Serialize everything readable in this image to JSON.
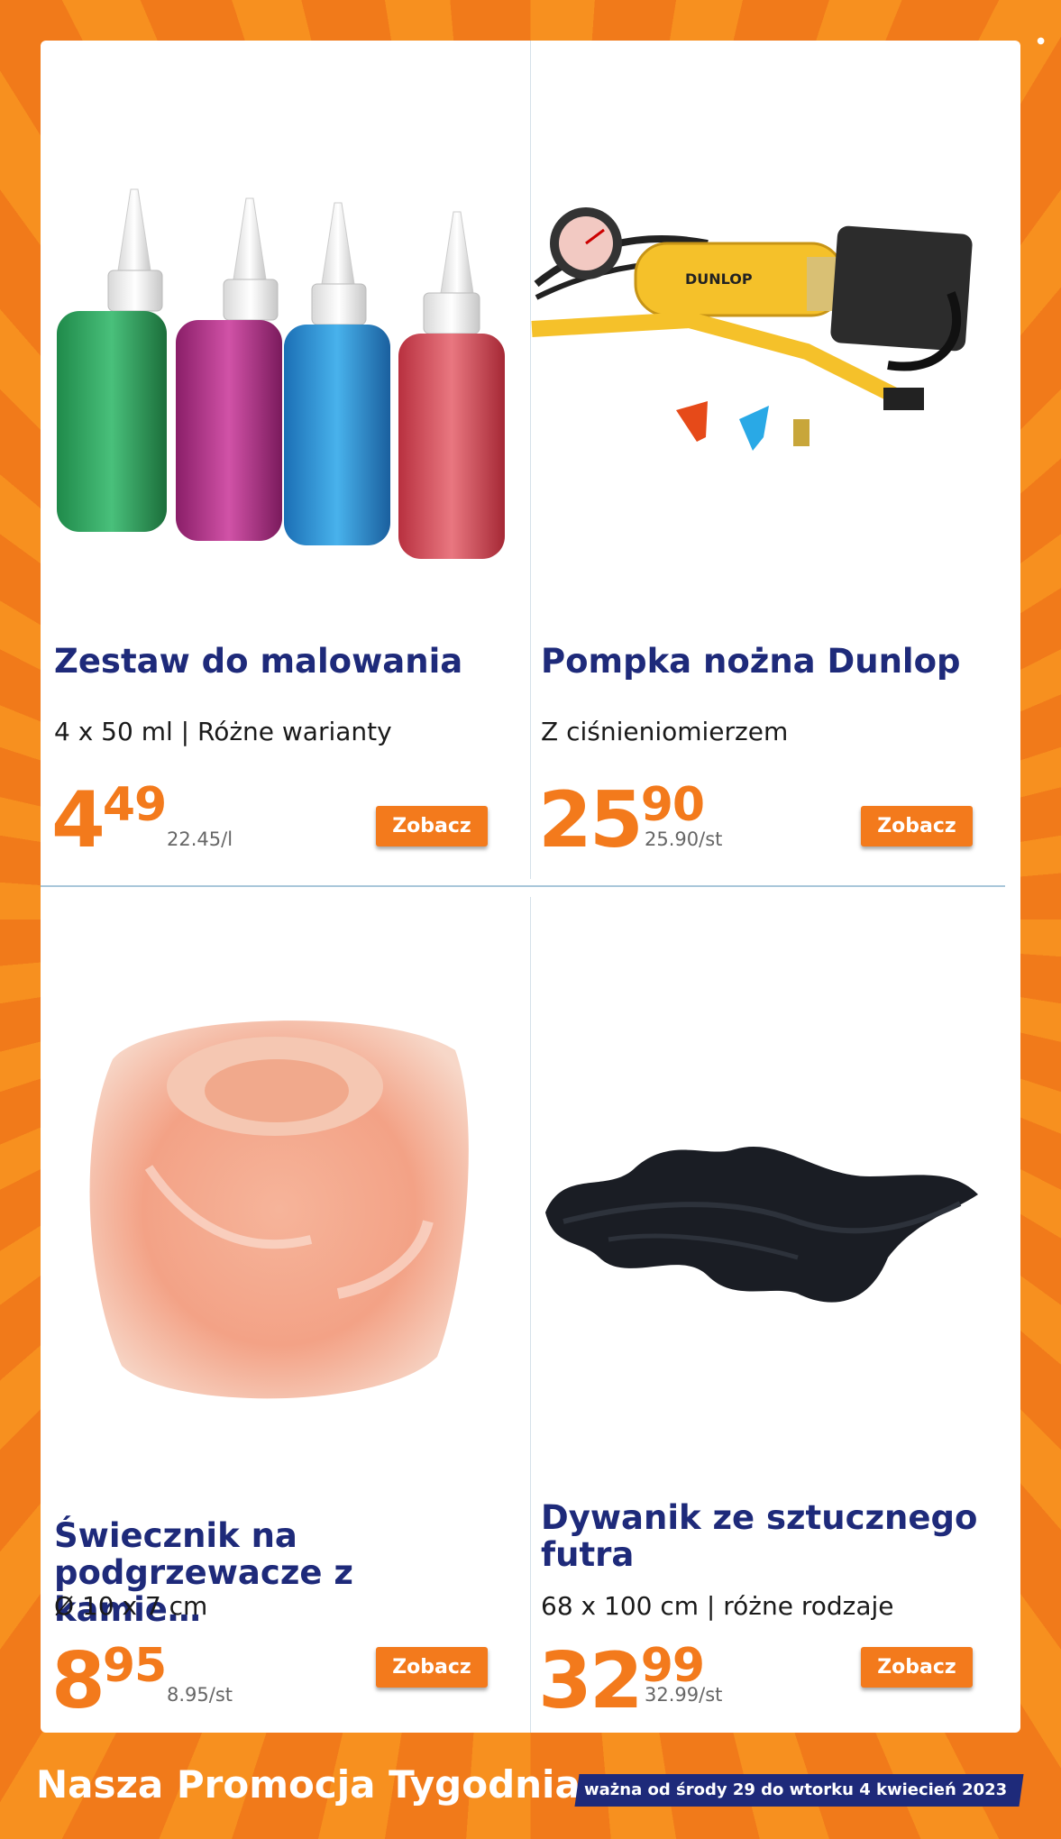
{
  "products": [
    {
      "title": "Zestaw do malowania",
      "subtitle": "4 x 50 ml | Różne warianty",
      "price_main": "4",
      "price_cents": "49",
      "unit_price": "22.45/l",
      "button": "Zobacz"
    },
    {
      "title": "Pompka nożna Dunlop",
      "subtitle": "Z ciśnieniomierzem",
      "price_main": "25",
      "price_cents": "90",
      "unit_price": "25.90/st",
      "button": "Zobacz"
    },
    {
      "title": "Świecznik na podgrzewacze z kamie…",
      "subtitle": "Ø 10 x 7 cm",
      "price_main": "8",
      "price_cents": "95",
      "unit_price": "8.95/st",
      "button": "Zobacz"
    },
    {
      "title": "Dywanik ze sztucznego futra",
      "subtitle": "68 x 100 cm | różne rodzaje",
      "price_main": "32",
      "price_cents": "99",
      "unit_price": "32.99/st",
      "button": "Zobacz"
    }
  ],
  "footer": {
    "title": "Nasza Promocja Tygodnia",
    "validity": "ważna od środy 29 do wtorku 4 kwiecień 2023"
  },
  "icons": {
    "product_1": "paint-bottles-image",
    "product_2": "foot-pump-image",
    "product_3": "salt-candle-holder-image",
    "product_4": "faux-fur-rug-image"
  },
  "colors": {
    "accent": "#f37a1c",
    "title": "#1e2a7a",
    "background": "#f6831f"
  }
}
